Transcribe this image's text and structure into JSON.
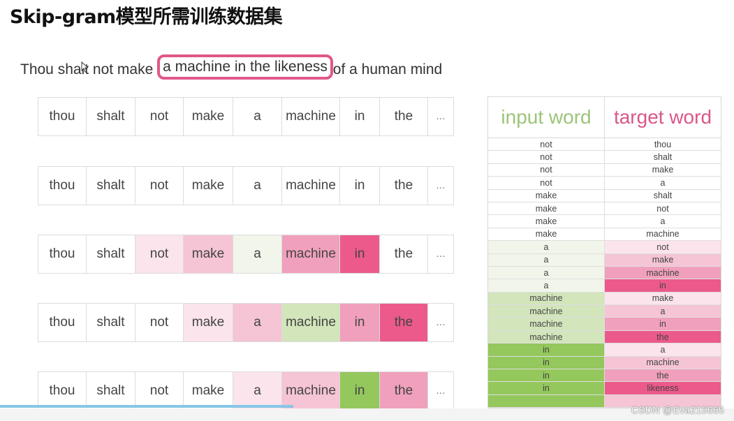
{
  "title": "Skip-gram模型所需训练数据集",
  "sentence": {
    "before": "Thou shalt not make",
    "highlighted": "a machine in the likeness",
    "after": "of a human mind"
  },
  "colors": {
    "white": "#ffffff",
    "pink_light": "#fbe4ec",
    "pink_mid": "#f5c4d5",
    "pink_strong": "#f0a0bc",
    "pink_dark": "#eb5a8a",
    "green_light": "#f1f5ea",
    "green_mid": "#d2e5bb",
    "green_dark": "#94c75c",
    "highlight_border": "#e0588a",
    "input_header": "#9bc47a",
    "target_header": "#d9578a"
  },
  "word_rows": [
    {
      "words": [
        "thou",
        "shalt",
        "not",
        "make",
        "a",
        "machine",
        "in",
        "the",
        "..."
      ],
      "shades": [
        "white",
        "white",
        "white",
        "white",
        "white",
        "white",
        "white",
        "white",
        "white"
      ]
    },
    {
      "words": [
        "thou",
        "shalt",
        "not",
        "make",
        "a",
        "machine",
        "in",
        "the",
        "..."
      ],
      "shades": [
        "white",
        "white",
        "white",
        "white",
        "white",
        "white",
        "white",
        "white",
        "white"
      ]
    },
    {
      "words": [
        "thou",
        "shalt",
        "not",
        "make",
        "a",
        "machine",
        "in",
        "the",
        "..."
      ],
      "shades": [
        "white",
        "white",
        "pink_light",
        "pink_mid",
        "green_light",
        "pink_strong",
        "pink_dark",
        "white",
        "white"
      ]
    },
    {
      "words": [
        "thou",
        "shalt",
        "not",
        "make",
        "a",
        "machine",
        "in",
        "the",
        "..."
      ],
      "shades": [
        "white",
        "white",
        "white",
        "pink_light",
        "pink_mid",
        "green_mid",
        "pink_strong",
        "pink_dark",
        "white"
      ]
    },
    {
      "words": [
        "thou",
        "shalt",
        "not",
        "make",
        "a",
        "machine",
        "in",
        "the",
        "..."
      ],
      "shades": [
        "white",
        "white",
        "white",
        "white",
        "pink_light",
        "pink_mid",
        "green_dark",
        "pink_strong",
        "white"
      ]
    }
  ],
  "pairs_table": {
    "headers": [
      "input word",
      "target word"
    ],
    "rows": [
      {
        "input": "not",
        "target": "thou",
        "in_shade": "white",
        "t_shade": "white"
      },
      {
        "input": "not",
        "target": "shalt",
        "in_shade": "white",
        "t_shade": "white"
      },
      {
        "input": "not",
        "target": "make",
        "in_shade": "white",
        "t_shade": "white"
      },
      {
        "input": "not",
        "target": "a",
        "in_shade": "white",
        "t_shade": "white"
      },
      {
        "input": "make",
        "target": "shalt",
        "in_shade": "white",
        "t_shade": "white"
      },
      {
        "input": "make",
        "target": "not",
        "in_shade": "white",
        "t_shade": "white"
      },
      {
        "input": "make",
        "target": "a",
        "in_shade": "white",
        "t_shade": "white"
      },
      {
        "input": "make",
        "target": "machine",
        "in_shade": "white",
        "t_shade": "white"
      },
      {
        "input": "a",
        "target": "not",
        "in_shade": "green_light",
        "t_shade": "pink_light"
      },
      {
        "input": "a",
        "target": "make",
        "in_shade": "green_light",
        "t_shade": "pink_mid"
      },
      {
        "input": "a",
        "target": "machine",
        "in_shade": "green_light",
        "t_shade": "pink_strong"
      },
      {
        "input": "a",
        "target": "in",
        "in_shade": "green_light",
        "t_shade": "pink_dark"
      },
      {
        "input": "machine",
        "target": "make",
        "in_shade": "green_mid",
        "t_shade": "pink_light"
      },
      {
        "input": "machine",
        "target": "a",
        "in_shade": "green_mid",
        "t_shade": "pink_mid"
      },
      {
        "input": "machine",
        "target": "in",
        "in_shade": "green_mid",
        "t_shade": "pink_strong"
      },
      {
        "input": "machine",
        "target": "the",
        "in_shade": "green_mid",
        "t_shade": "pink_dark"
      },
      {
        "input": "in",
        "target": "a",
        "in_shade": "green_dark",
        "t_shade": "pink_light"
      },
      {
        "input": "in",
        "target": "machine",
        "in_shade": "green_dark",
        "t_shade": "pink_mid"
      },
      {
        "input": "in",
        "target": "the",
        "in_shade": "green_dark",
        "t_shade": "pink_strong"
      },
      {
        "input": "in",
        "target": "likeness",
        "in_shade": "green_dark",
        "t_shade": "pink_dark"
      },
      {
        "input": "",
        "target": "",
        "in_shade": "green_dark",
        "t_shade": "pink_mid"
      }
    ]
  },
  "watermark": "CSDN @Eva215665",
  "video_progress": 0.4
}
